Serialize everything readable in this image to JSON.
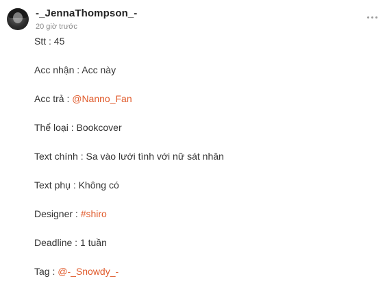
{
  "post": {
    "author": "-_JennaThompson_-",
    "timestamp": "20 giờ trước",
    "menu_icon": "more-horizontal-icon",
    "avatar_icon": "user-avatar-photo",
    "accent_color": "#e05a2b"
  },
  "lines": {
    "stt": {
      "label": "Stt : ",
      "value": "45"
    },
    "acc_nhan": {
      "label": "Acc nhận : ",
      "value": "Acc này"
    },
    "acc_tra": {
      "label": "Acc trả : ",
      "link": "@Nanno_Fan"
    },
    "the_loai": {
      "label": "Thể loại : ",
      "value": "Bookcover"
    },
    "text_chinh": {
      "label": "Text chính : ",
      "value": "Sa vào lưới tình với nữ sát nhân"
    },
    "text_phu": {
      "label": "Text phụ : ",
      "value": "Không có"
    },
    "designer": {
      "label": "Designer : ",
      "link": "#shiro"
    },
    "deadline": {
      "label": "Deadline : ",
      "value": "1 tuần"
    },
    "tag": {
      "label": "Tag : ",
      "link": "@-_Snowdy_-"
    }
  }
}
